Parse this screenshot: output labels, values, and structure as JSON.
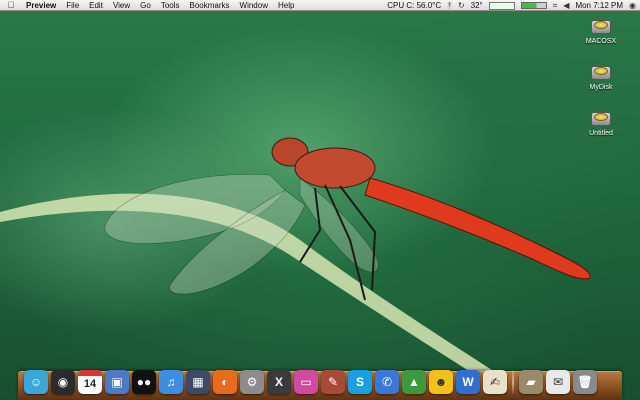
{
  "menubar": {
    "apple_icon": "apple-logo-icon",
    "app_name": "Preview",
    "menus": [
      "File",
      "Edit",
      "View",
      "Go",
      "Tools",
      "Bookmarks",
      "Window",
      "Help"
    ],
    "cpu_temp": "CPU C: 56.0°C",
    "temp_secondary": "32°",
    "clock": "Mon 7:12 PM"
  },
  "desktop_icons": [
    {
      "label": "MACOSX",
      "icon": "hard-drive-icon"
    },
    {
      "label": "MyDisk",
      "icon": "hard-drive-icon"
    },
    {
      "label": "Untitled",
      "icon": "hard-drive-icon"
    }
  ],
  "dock": {
    "calendar_day": "14",
    "apps": [
      {
        "name": "finder-icon",
        "color": "#3aa7d8",
        "glyph": "☺"
      },
      {
        "name": "dashboard-icon",
        "color": "#2b2b2b",
        "glyph": "◉"
      },
      {
        "name": "ical-icon",
        "color": "#fafafa",
        "glyph": ""
      },
      {
        "name": "preview-icon",
        "color": "#4a7bc4",
        "glyph": "▣"
      },
      {
        "name": "adium-icon",
        "color": "#111111",
        "glyph": "●●"
      },
      {
        "name": "itunes-icon",
        "color": "#3b8ee0",
        "glyph": "♫"
      },
      {
        "name": "expose-icon",
        "color": "#3c4a66",
        "glyph": "▦"
      },
      {
        "name": "firefox-icon",
        "color": "#e86a1f",
        "glyph": "◐"
      },
      {
        "name": "system-preferences-icon",
        "color": "#8c8c8c",
        "glyph": "⚙"
      },
      {
        "name": "x11-icon",
        "color": "#3a3a3a",
        "glyph": "X"
      },
      {
        "name": "photo-booth-icon",
        "color": "#d04aa0",
        "glyph": "▭"
      },
      {
        "name": "script-editor-icon",
        "color": "#a84a3a",
        "glyph": "✎"
      },
      {
        "name": "skype-icon",
        "color": "#19a0e0",
        "glyph": "S"
      },
      {
        "name": "ichat-icon",
        "color": "#3a78d8",
        "glyph": "✆"
      },
      {
        "name": "transmission-icon",
        "color": "#3c9a3c",
        "glyph": "▲"
      },
      {
        "name": "messenger-icon",
        "color": "#f2c21a",
        "glyph": "☻"
      },
      {
        "name": "word-icon",
        "color": "#2f6fd0",
        "glyph": "W"
      },
      {
        "name": "textedit-icon",
        "color": "#e8e0c8",
        "glyph": "✍"
      },
      {
        "name": "documents-folder-icon",
        "color": "#9a8a6a",
        "glyph": "▰"
      },
      {
        "name": "mail-icon",
        "color": "#e9e9e9",
        "glyph": "✉"
      },
      {
        "name": "trash-icon",
        "color": "#8a8a8a",
        "glyph": "🗑"
      }
    ]
  }
}
